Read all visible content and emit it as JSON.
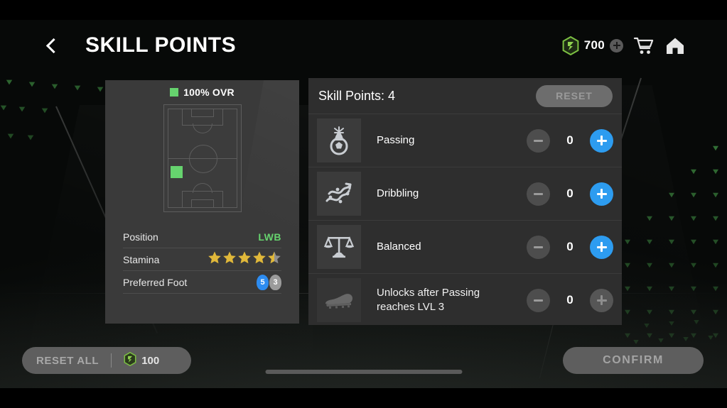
{
  "header": {
    "back_icon": "chevron-left-icon",
    "title": "SKILL POINTS",
    "currency": {
      "icon": "green-hex-token-icon",
      "amount": "700",
      "add_label": "+"
    },
    "shop_icon": "cart-icon",
    "home_icon": "home-icon"
  },
  "player_card": {
    "ovr_label": "100% OVR",
    "stats": [
      {
        "label": "Position",
        "value": "LWB"
      },
      {
        "label": "Stamina",
        "value": "4.5",
        "stars_full": 4,
        "stars_half": 1,
        "stars_total": 5
      },
      {
        "label": "Preferred Foot",
        "left_foot": "5",
        "right_foot": "3"
      }
    ]
  },
  "panel": {
    "title": "Skill Points: 4",
    "reset_label": "RESET",
    "skills": [
      {
        "icon": "passing-ball-icon",
        "name": "Passing",
        "value": "0",
        "minus_enabled": false,
        "plus_enabled": true,
        "locked": false
      },
      {
        "icon": "dribbling-slalom-icon",
        "name": "Dribbling",
        "value": "0",
        "minus_enabled": false,
        "plus_enabled": true,
        "locked": false
      },
      {
        "icon": "balanced-scales-icon",
        "name": "Balanced",
        "value": "0",
        "minus_enabled": false,
        "plus_enabled": true,
        "locked": false
      },
      {
        "icon": "boot-icon",
        "name": "Unlocks after Passing reaches LVL 3",
        "value": "0",
        "minus_enabled": false,
        "plus_enabled": false,
        "locked": true
      }
    ]
  },
  "footer": {
    "reset_all_label": "RESET ALL",
    "reset_all_cost": "100",
    "reset_all_cost_icon": "green-hex-token-icon",
    "confirm_label": "CONFIRM"
  },
  "colors": {
    "accent_green": "#66d36e",
    "accent_blue": "#2d9cf0",
    "star_gold": "#e0b83a",
    "panel_bg": "#2e2e2e",
    "card_bg": "#3a3a3a"
  }
}
